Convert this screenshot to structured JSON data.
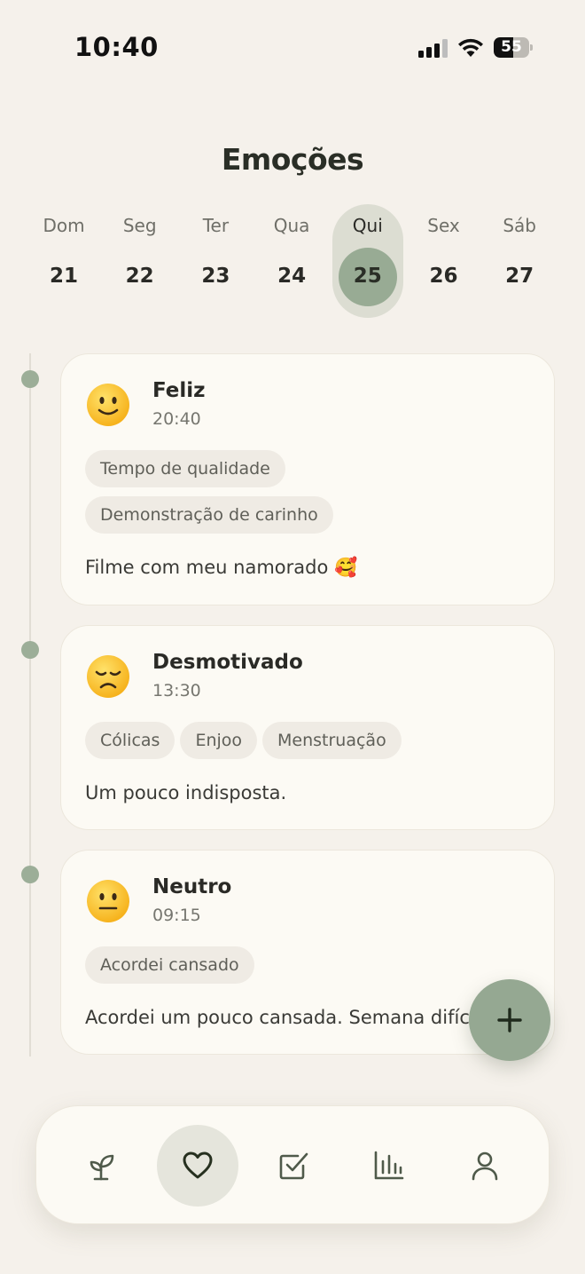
{
  "status_bar": {
    "time": "10:40",
    "battery_level": "55",
    "signal_bars": 3,
    "wifi": true
  },
  "page_title": "Emoções",
  "week": {
    "selected_index": 4,
    "days": [
      {
        "label": "Dom",
        "number": "21"
      },
      {
        "label": "Seg",
        "number": "22"
      },
      {
        "label": "Ter",
        "number": "23"
      },
      {
        "label": "Qua",
        "number": "24"
      },
      {
        "label": "Qui",
        "number": "25"
      },
      {
        "label": "Sex",
        "number": "26"
      },
      {
        "label": "Sáb",
        "number": "27"
      }
    ]
  },
  "entries": [
    {
      "emoji": "slightly-smiling-face",
      "mood": "Feliz",
      "time": "20:40",
      "tags": [
        "Tempo de qualidade",
        "Demonstração de carinho"
      ],
      "note": "Filme com meu namorado 🥰"
    },
    {
      "emoji": "disappointed-face",
      "mood": "Desmotivado",
      "time": "13:30",
      "tags": [
        "Cólicas",
        "Enjoo",
        "Menstruação"
      ],
      "note": "Um pouco indisposta."
    },
    {
      "emoji": "neutral-face",
      "mood": "Neutro",
      "time": "09:15",
      "tags": [
        "Acordei cansado"
      ],
      "note": "Acordei um pouco cansada. Semana difíc"
    }
  ],
  "fab": {
    "icon": "plus-icon"
  },
  "bottom_nav": {
    "active_index": 1,
    "items": [
      {
        "icon": "sprout-icon"
      },
      {
        "icon": "heart-icon"
      },
      {
        "icon": "checkbox-icon"
      },
      {
        "icon": "bar-chart-icon"
      },
      {
        "icon": "user-icon"
      }
    ]
  },
  "colors": {
    "background": "#f5f1eb",
    "accent": "#98ab94",
    "card": "#fcfaf4",
    "tag": "#efebe4"
  }
}
